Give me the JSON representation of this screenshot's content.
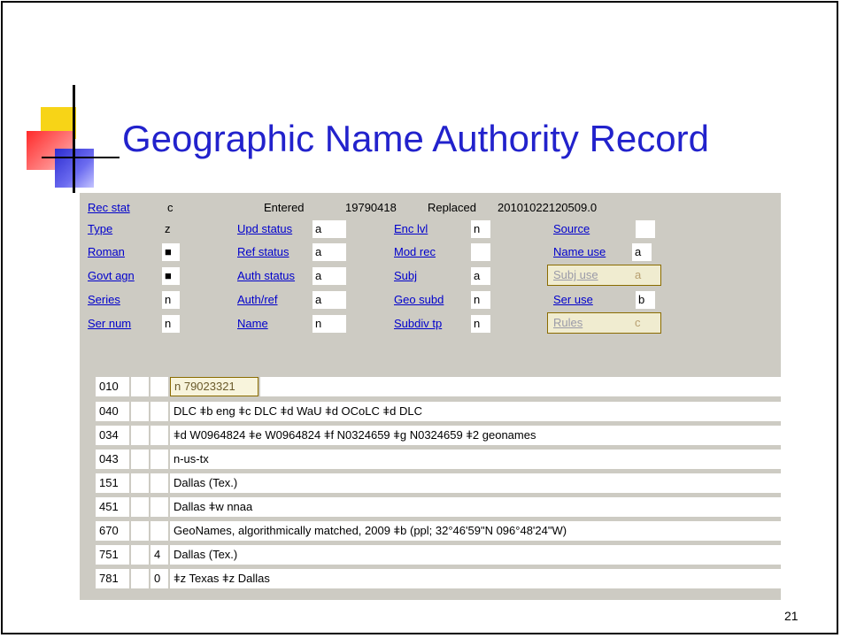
{
  "slide": {
    "title": "Geographic Name Authority Record",
    "page_number": "21"
  },
  "fixed_fields": {
    "rec_stat": {
      "label": "Rec stat",
      "value": "c"
    },
    "entered": {
      "label": "Entered",
      "value": "19790418"
    },
    "replaced": {
      "label": "Replaced",
      "value": "20101022120509.0"
    },
    "type": {
      "label": "Type",
      "value": "z"
    },
    "upd_status": {
      "label": "Upd status",
      "value": "a"
    },
    "enc_lvl": {
      "label": "Enc lvl",
      "value": "n"
    },
    "source": {
      "label": "Source",
      "value": ""
    },
    "roman": {
      "label": "Roman",
      "value": "■"
    },
    "ref_status": {
      "label": "Ref status",
      "value": "a"
    },
    "mod_rec": {
      "label": "Mod rec",
      "value": ""
    },
    "name_use": {
      "label": "Name use",
      "value": "a"
    },
    "govt_agn": {
      "label": "Govt agn",
      "value": "■"
    },
    "auth_status": {
      "label": "Auth status",
      "value": "a"
    },
    "subj": {
      "label": "Subj",
      "value": "a"
    },
    "subj_use": {
      "label": "Subj use",
      "value": "a"
    },
    "series": {
      "label": "Series",
      "value": "n"
    },
    "auth_ref": {
      "label": "Auth/ref",
      "value": "a"
    },
    "geo_subd": {
      "label": "Geo subd",
      "value": "n"
    },
    "ser_use": {
      "label": "Ser use",
      "value": "b"
    },
    "ser_num": {
      "label": "Ser num",
      "value": "n"
    },
    "name": {
      "label": "Name",
      "value": "n"
    },
    "subdiv_tp": {
      "label": "Subdiv tp",
      "value": "n"
    },
    "rules": {
      "label": "Rules",
      "value": "c"
    }
  },
  "variable_fields": [
    {
      "tag": "010",
      "ind1": "",
      "ind2": "",
      "content": "n 79023321"
    },
    {
      "tag": "040",
      "ind1": "",
      "ind2": "",
      "content": "DLC ǂb eng ǂc DLC ǂd WaU ǂd OCoLC ǂd DLC"
    },
    {
      "tag": "034",
      "ind1": "",
      "ind2": "",
      "content": "ǂd W0964824 ǂe W0964824 ǂf N0324659 ǂg N0324659 ǂ2 geonames"
    },
    {
      "tag": "043",
      "ind1": "",
      "ind2": "",
      "content": "n-us-tx"
    },
    {
      "tag": "151",
      "ind1": "",
      "ind2": "",
      "content": "Dallas (Tex.)"
    },
    {
      "tag": "451",
      "ind1": "",
      "ind2": "",
      "content": "Dallas ǂw nnaa"
    },
    {
      "tag": "670",
      "ind1": "",
      "ind2": "",
      "content": "GeoNames, algorithmically matched, 2009 ǂb (ppl; 32°46'59\"N 096°48'24\"W)"
    },
    {
      "tag": "751",
      "ind1": "",
      "ind2": "4",
      "content": "Dallas (Tex.)"
    },
    {
      "tag": "781",
      "ind1": "",
      "ind2": "0",
      "content": "ǂz Texas ǂz Dallas"
    }
  ]
}
